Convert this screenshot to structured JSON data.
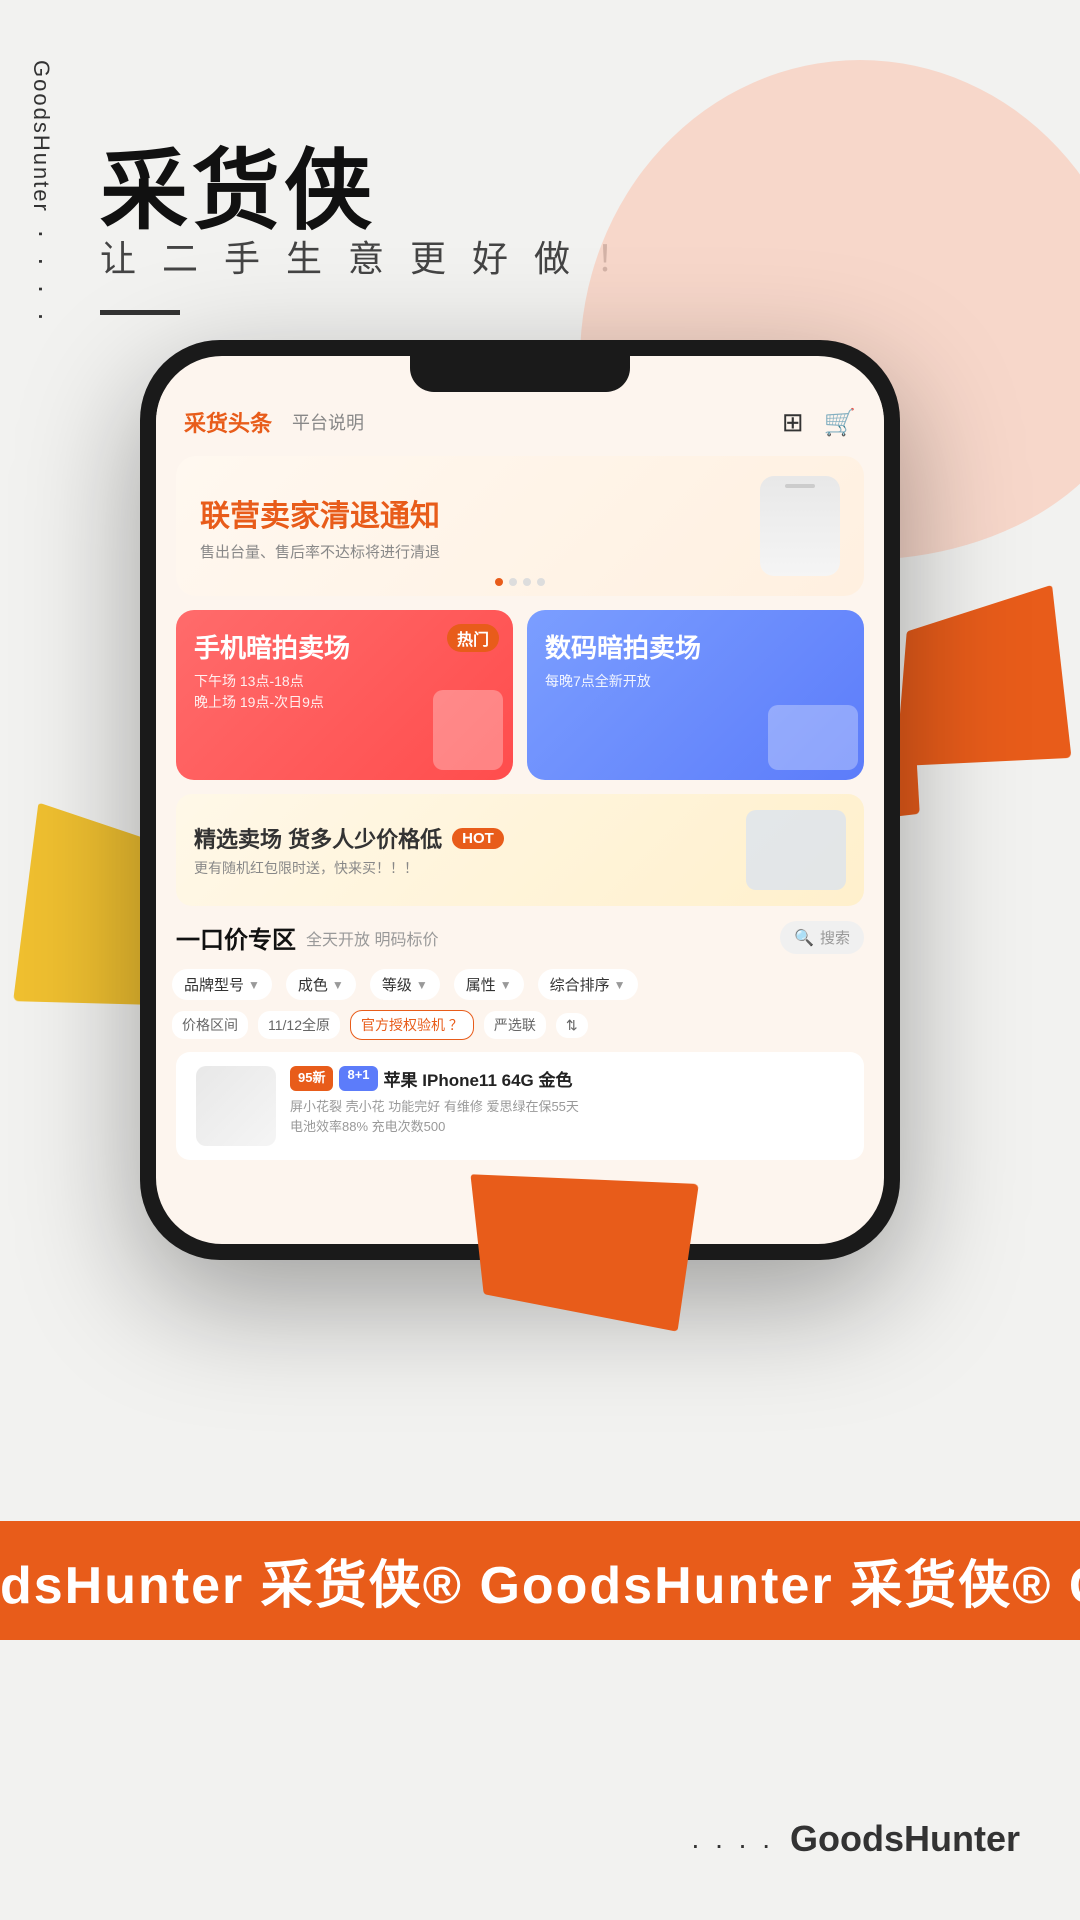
{
  "brand": {
    "name": "GoodsHunter",
    "vertical_text": "GoodsHunter",
    "dots": ". . . .",
    "hero_title": "采货侠",
    "hero_subtitle": "让 二 手 生 意 更 好 做 ！"
  },
  "app": {
    "header": {
      "tab_active": "采货头条",
      "tab_inactive": "平台说明",
      "icon1": "⊞",
      "icon2": "🛒"
    },
    "banner": {
      "title": "联营卖家清退通知",
      "subtitle": "售出台量、售后率不达标将进行清退"
    },
    "categories": [
      {
        "title": "手机暗拍卖场",
        "badge": "热门",
        "desc_line1": "下午场 13点-18点",
        "desc_line2": "晚上场 19点-次日9点"
      },
      {
        "title": "数码暗拍卖场",
        "desc_line1": "每晚7点全新开放"
      }
    ],
    "featured": {
      "title": "精选卖场  货多人少价格低",
      "badge": "HOT",
      "subtitle": "更有随机红包限时送，快来买！！！"
    },
    "one_price": {
      "title": "一口价专区",
      "subtitle": "全天开放 明码标价",
      "search_placeholder": "搜索"
    },
    "filters": [
      {
        "label": "品牌型号",
        "arrow": "▼"
      },
      {
        "label": "成色",
        "arrow": "▼"
      },
      {
        "label": "等级",
        "arrow": "▼"
      },
      {
        "label": "属性",
        "arrow": "▼"
      },
      {
        "label": "综合排序",
        "arrow": "▼"
      }
    ],
    "filters2": [
      {
        "label": "价格区间",
        "arrow": "▼"
      },
      {
        "label": "11/12全原"
      },
      {
        "label": "官方授权验机 ？",
        "active": true
      },
      {
        "label": "严选联"
      },
      {
        "label": "⇅"
      }
    ],
    "product": {
      "badge1": "95新",
      "badge2": "8+1",
      "name": "苹果 IPhone11 64G 金色",
      "desc1": "屏小花裂   壳小花   功能完好   有维修   爱思绿在保55天",
      "desc2": "电池效率88%   充电次数500"
    }
  },
  "bottom_banner": {
    "text": "dsHunter 采货侠®    GoodsHunter 采货侠®    Goo"
  },
  "footer": {
    "dots": ". . . .",
    "brand": "GoodsHunter"
  }
}
